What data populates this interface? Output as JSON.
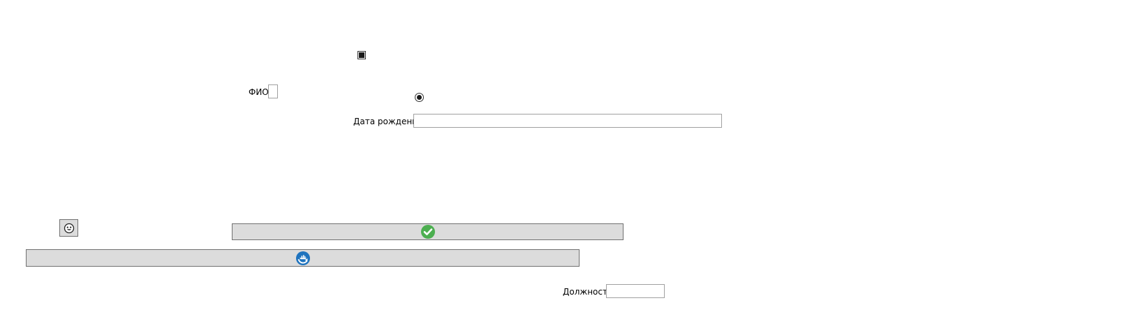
{
  "form": {
    "checkbox": {
      "checked": true
    },
    "radio": {
      "selected": true
    },
    "fio": {
      "label": "ФИО",
      "value": ""
    },
    "birth_date": {
      "label": "Дата рождения",
      "value": ""
    },
    "position": {
      "label": "Должность",
      "value": ""
    }
  },
  "buttons": {
    "face": {
      "icon": "face-icon"
    },
    "confirm": {
      "icon": "check-circle-icon",
      "color": "#4caf50"
    },
    "sync": {
      "icon": "sync-ship-icon",
      "color": "#1e73be"
    }
  }
}
